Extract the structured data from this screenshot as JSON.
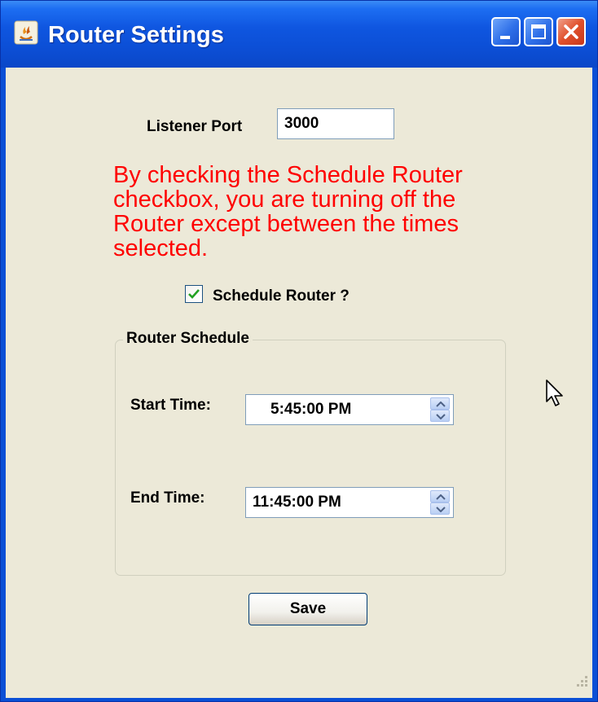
{
  "window": {
    "title": "Router Settings",
    "controls": {
      "minimize": "minimize-icon",
      "maximize": "maximize-icon",
      "close": "close-icon"
    }
  },
  "form": {
    "listener_port_label": "Listener Port",
    "listener_port_value": "3000",
    "warning_text": "By checking the Schedule Router checkbox, you are turning off the Router except between the times selected.",
    "schedule_checkbox_label": "Schedule Router ?",
    "schedule_checked": true,
    "schedule_group": {
      "legend": "Router Schedule",
      "start_time_label": "Start Time:",
      "start_time_value": "5:45:00 PM",
      "end_time_label": "End Time:",
      "end_time_value": "11:45:00 PM"
    },
    "save_label": "Save"
  },
  "colors": {
    "titlebar": "#0c4fd6",
    "client_bg": "#ece9d8",
    "warning": "#ff0000",
    "close_button": "#e0502c"
  }
}
